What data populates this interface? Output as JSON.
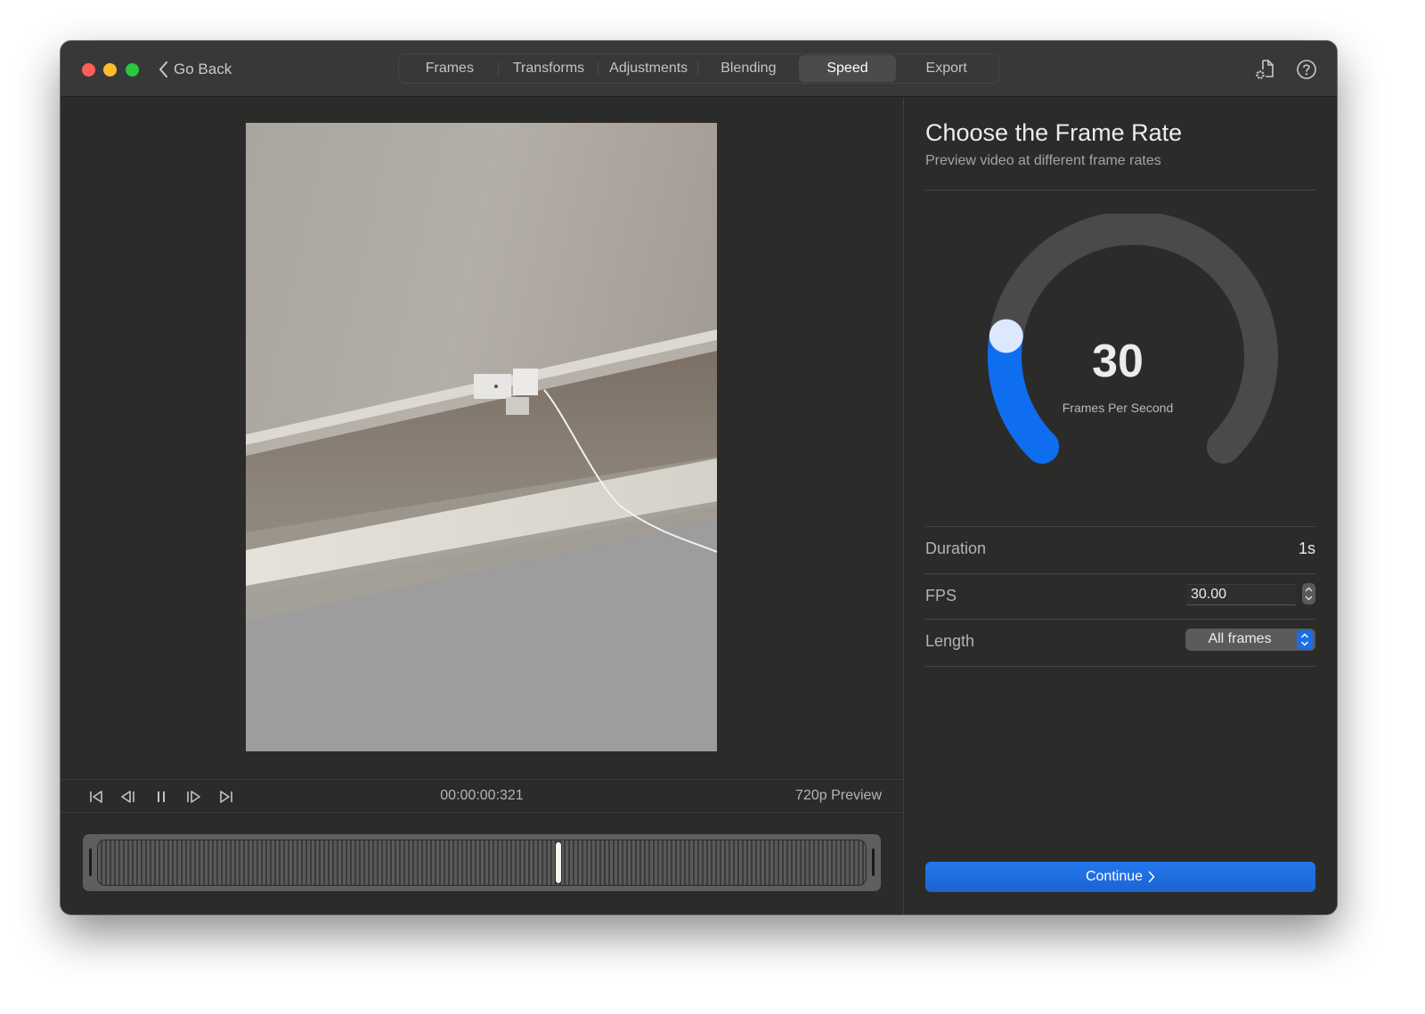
{
  "window": {
    "back_label": "Go Back",
    "tabs": [
      {
        "label": "Frames",
        "active": false
      },
      {
        "label": "Transforms",
        "active": false
      },
      {
        "label": "Adjustments",
        "active": false
      },
      {
        "label": "Blending",
        "active": false
      },
      {
        "label": "Speed",
        "active": true
      },
      {
        "label": "Export",
        "active": false
      }
    ],
    "toolbar_icons": [
      "document-settings-icon",
      "help-icon"
    ]
  },
  "player": {
    "timecode": "00:00:00:321",
    "quality": "720p Preview",
    "controls": [
      "skip-to-start-icon",
      "step-back-icon",
      "pause-icon",
      "step-forward-icon",
      "skip-to-end-icon"
    ],
    "playhead_fraction": 0.6
  },
  "panel": {
    "title": "Choose the Frame Rate",
    "subtitle": "Preview video at different frame rates",
    "gauge": {
      "value": "30",
      "label": "Frames Per Second",
      "fill_fraction": 0.2,
      "fill_color": "#0f6ef0",
      "track_color": "#4a4a4a",
      "knob_color": "#dbe8fd"
    },
    "rows": {
      "duration": {
        "label": "Duration",
        "value": "1s"
      },
      "fps": {
        "label": "FPS",
        "value": "30.00"
      },
      "length": {
        "label": "Length",
        "value": "All frames"
      }
    },
    "continue_label": "Continue"
  },
  "colors": {
    "accent": "#1c6ae4",
    "window_bg": "#2b2b2a",
    "titlebar_bg": "#383838"
  }
}
